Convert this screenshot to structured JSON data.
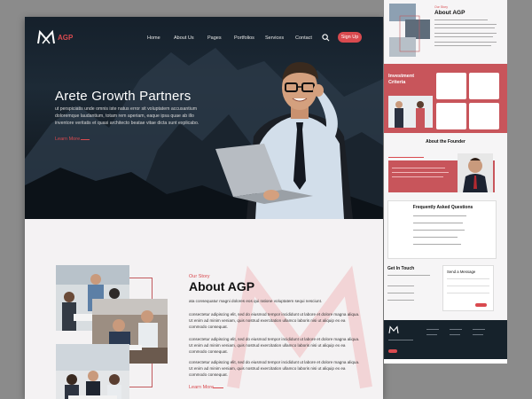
{
  "brand": {
    "name": "AGP",
    "accent": "#d94a4f",
    "dark": "#16222b"
  },
  "nav": {
    "items": [
      "Home",
      "About Us",
      "Pages",
      "Portfolios",
      "Services",
      "Contact"
    ],
    "search_icon": "search-icon",
    "signup_label": "Sign Up"
  },
  "hero": {
    "title": "Arete Growth Partners",
    "text": "ut perspiciatis unde omnis iste natus error sit voluptatem accusantium doloremque laudantium, totam rem aperiam, eaque ipsa quae ab illo inventore veritatis et quasi architecto beatae vitae dicta sunt explicabo.",
    "link_label": "Learn More"
  },
  "about": {
    "eyebrow": "Our Story",
    "title": "About AGP",
    "paragraphs": [
      "ata consequatur magni dolores eos qui ratione voluptatem sequi nesciunt.",
      "consectetur adipiscing elit, sed do eiusmod tempor incididunt ut labore et dolore magna aliqua. Ut enim ad minim veniam, quis nostrud exercitation ullamco laboris nisi ut aliquip ex ea commodo consequat.",
      "consectetur adipiscing elit, sed do eiusmod tempor incididunt ut labore et dolore magna aliqua. Ut enim ad minim veniam, quis nostrud exercitation ullamco laboris nisi ut aliquip ex ea commodo consequat.",
      "consectetur adipiscing elit, sed do eiusmod tempor incididunt ut labore et dolore magna aliqua. Ut enim ad minim veniam, quis nostrud exercitation ullamco laboris nisi ut aliquip ex ea commodo consequat."
    ],
    "link_label": "Learn More"
  },
  "side": {
    "about_eyebrow": "Our Story",
    "about_title": "About AGP",
    "invest_title": "Investment Criteria",
    "founder_title": "About the Founder",
    "faq_title": "Frequently Asked Questions",
    "contact_title": "Get In Touch",
    "message_title": "Send a Message"
  }
}
